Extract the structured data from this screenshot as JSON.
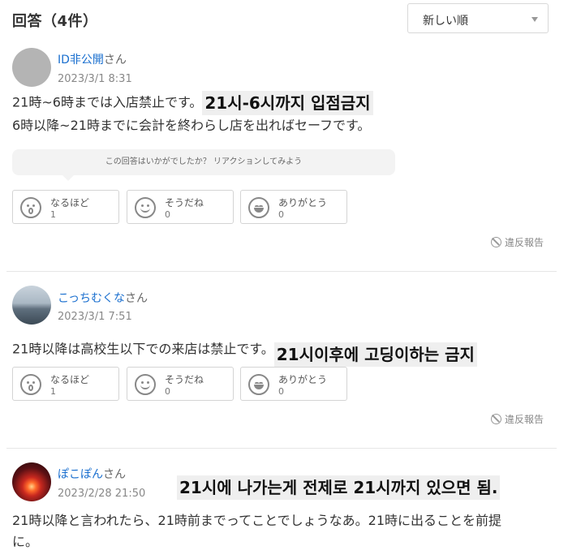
{
  "header": {
    "title": "回答（4件）",
    "sort_label": "新しい順"
  },
  "reaction_prompt": "この回答はいかがでしたか？ リアクションしてみよう",
  "report_label": "違反報告",
  "answers": [
    {
      "user": "ID非公開",
      "suffix": "さん",
      "date": "2023/3/1 8:31",
      "line1": "21時~6時までは入店禁止です。",
      "overlay": "21시-6시까지 입점금지",
      "line2": "6時以降~21時までに会計を終わらし店を出ればセーフです。",
      "reactions": [
        {
          "label": "なるほど",
          "count": "1",
          "icon": "surprised-face-icon"
        },
        {
          "label": "そうだね",
          "count": "0",
          "icon": "smile-face-icon"
        },
        {
          "label": "ありがとう",
          "count": "0",
          "icon": "grin-face-icon"
        }
      ]
    },
    {
      "user": "こっちむくな",
      "suffix": "さん",
      "date": "2023/3/1 7:51",
      "line1": "21時以降は高校生以下での来店は禁止です。",
      "overlay": "21시이후에 고딩이하는 금지",
      "reactions": [
        {
          "label": "なるほど",
          "count": "1",
          "icon": "surprised-face-icon"
        },
        {
          "label": "そうだね",
          "count": "0",
          "icon": "smile-face-icon"
        },
        {
          "label": "ありがとう",
          "count": "0",
          "icon": "grin-face-icon"
        }
      ]
    },
    {
      "user": "ぽこぽん",
      "suffix": "さん",
      "date": "2023/2/28 21:50",
      "overlay": "21시에 나가는게 전제로 21시까지 있으면 됨.",
      "line1": "21時以降と言われたら、21時前までってことでしょうなあ。21時に出ることを前提",
      "line2": "に。"
    }
  ]
}
